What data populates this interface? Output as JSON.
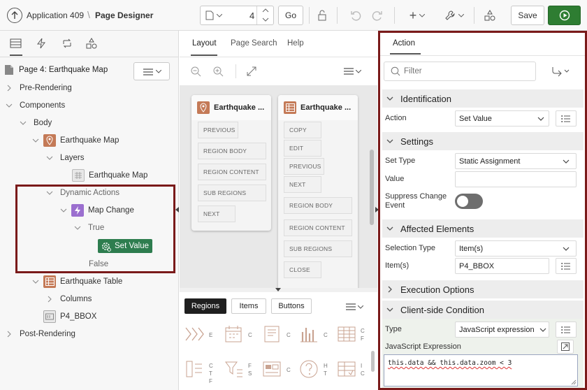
{
  "header": {
    "app_name": "Application 409",
    "page_designer": "Page Designer",
    "page_number": "4",
    "go_label": "Go",
    "save_label": "Save"
  },
  "left": {
    "page_title": "Page 4: Earthquake Map",
    "tree": {
      "pre_rendering": "Pre-Rendering",
      "components": "Components",
      "body": "Body",
      "earthquake_map": "Earthquake Map",
      "layers": "Layers",
      "layer_earthquake_map": "Earthquake Map",
      "dynamic_actions": "Dynamic Actions",
      "map_change": "Map Change",
      "true": "True",
      "set_value": "Set Value",
      "false": "False",
      "earthquake_table": "Earthquake Table",
      "columns": "Columns",
      "p4_bbox": "P4_BBOX",
      "post_rendering": "Post-Rendering"
    }
  },
  "middle": {
    "tabs": [
      "Layout",
      "Page Search",
      "Help"
    ],
    "card1": {
      "title": "Earthquake ...",
      "slots": [
        "PREVIOUS",
        "REGION BODY",
        "REGION CONTENT",
        "SUB REGIONS",
        "NEXT"
      ]
    },
    "card2": {
      "title": "Earthquake ...",
      "slots": [
        "COPY",
        "EDIT",
        "PREVIOUS",
        "NEXT",
        "REGION BODY",
        "REGION CONTENT",
        "SUB REGIONS",
        "CLOSE"
      ]
    },
    "gallery_tabs": [
      "Regions",
      "Items",
      "Buttons"
    ],
    "gallery_labels": [
      "E",
      "C",
      "C",
      "C\nF",
      "C\nT\nF",
      "F\nS",
      "C",
      "H\nT",
      "I\nC"
    ]
  },
  "right": {
    "tab": "Action",
    "filter_placeholder": "Filter",
    "sections": {
      "identification": "Identification",
      "settings": "Settings",
      "affected": "Affected Elements",
      "execution": "Execution Options",
      "client": "Client-side Condition"
    },
    "fields": {
      "action_label": "Action",
      "action_value": "Set Value",
      "set_type_label": "Set Type",
      "set_type_value": "Static Assignment",
      "value_label": "Value",
      "suppress_label": "Suppress Change Event",
      "selection_type_label": "Selection Type",
      "selection_type_value": "Item(s)",
      "items_label": "Item(s)",
      "items_value": "P4_BBOX",
      "type_label": "Type",
      "type_value": "JavaScript expression",
      "js_label": "JavaScript Expression",
      "js_value": "this.data && this.data.zoom < 3"
    }
  },
  "colors": {
    "highlight_border": "#7a1a1a",
    "run_green": "#2e7d32",
    "set_value_green": "#2e7d4f",
    "region_orange": "#c47a57",
    "da_purple": "#9b6fcf"
  }
}
